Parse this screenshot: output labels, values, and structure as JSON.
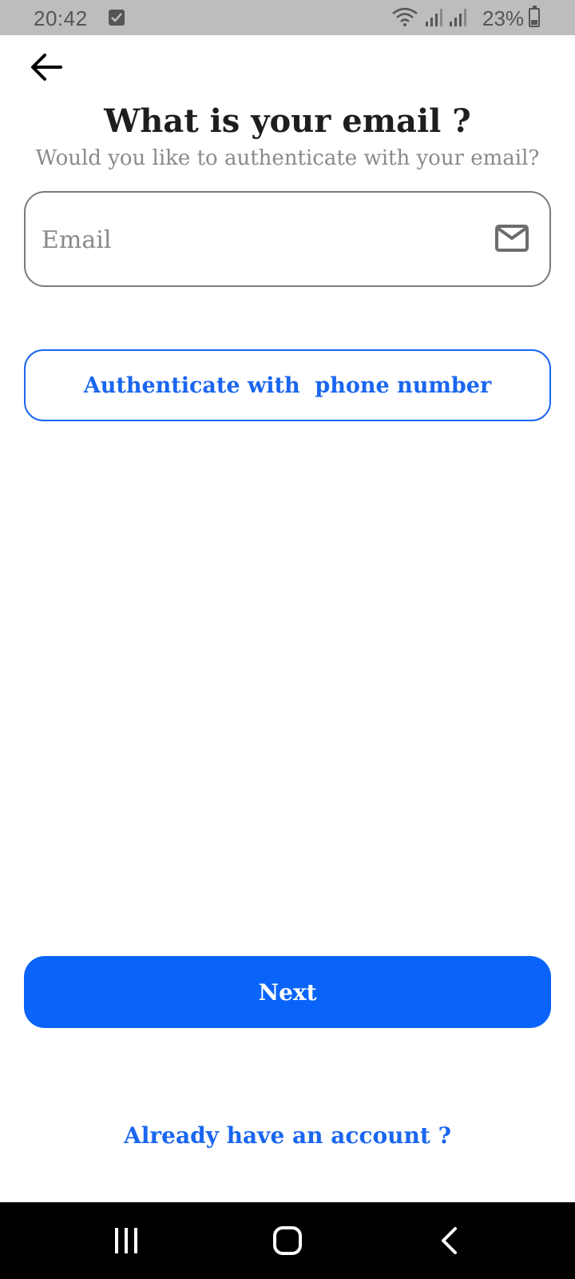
{
  "status_bar": {
    "time": "20:42",
    "battery": "23%"
  },
  "header": {
    "title": "What is your email ?",
    "subtitle": "Would you like to authenticate with your email?"
  },
  "email_field": {
    "placeholder": "Email",
    "value": ""
  },
  "buttons": {
    "phone_auth": "Authenticate with  phone number",
    "next": "Next"
  },
  "footer": {
    "login_link": "Already have an account ?"
  },
  "colors": {
    "accent": "#0a64fa",
    "status_bar": "#bdbdbd",
    "title": "#1e1e1e",
    "muted": "#8a8a8a"
  },
  "icons": [
    "back-arrow-icon",
    "mail-icon",
    "wifi-icon",
    "signal-icon",
    "battery-icon",
    "checkbox-notification-icon",
    "recent-apps-icon",
    "home-icon",
    "nav-back-icon"
  ]
}
